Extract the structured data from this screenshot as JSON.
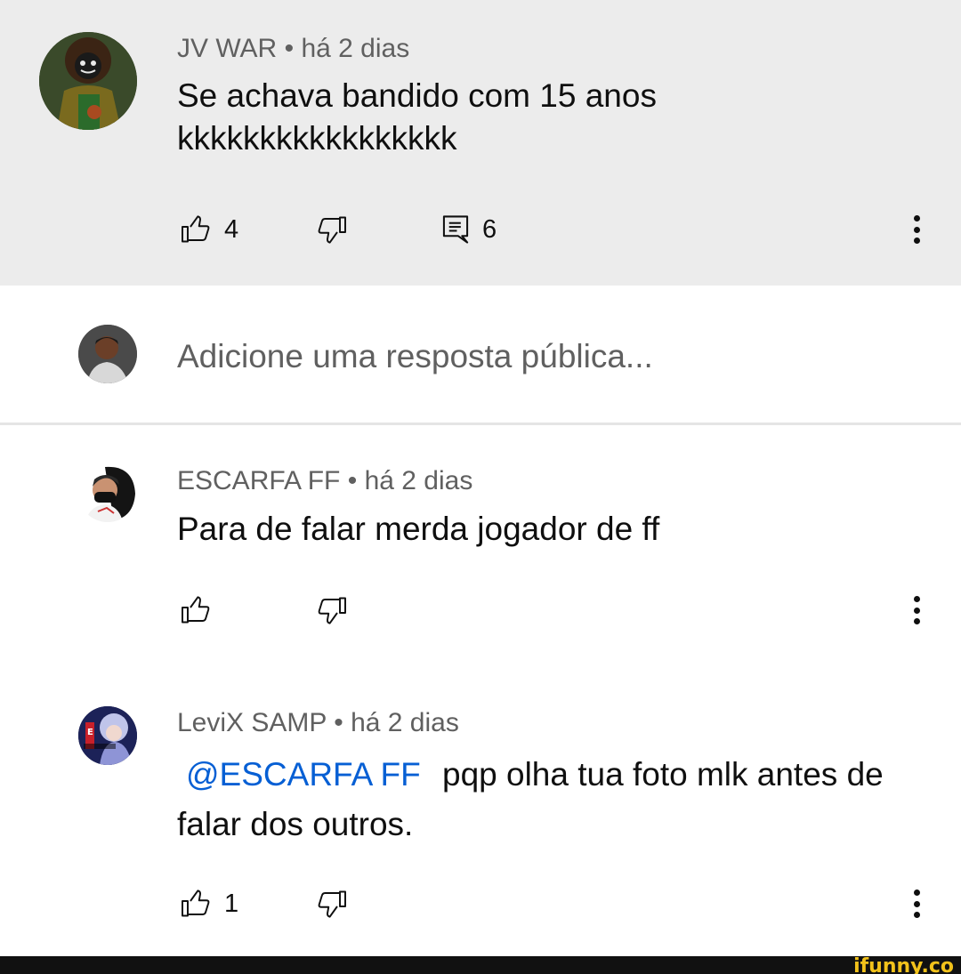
{
  "comment_main": {
    "author": "JV WAR",
    "separator": "•",
    "time": "há 2 dias",
    "text_line1": "Se achava bandido com 15 anos",
    "text_line2": "kkkkkkkkkkkkkkkkk",
    "likes": "4",
    "replies": "6",
    "avatar_icon": "jv-war-avatar"
  },
  "composer": {
    "placeholder": "Adicione uma resposta pública...",
    "avatar_icon": "current-user-avatar"
  },
  "replies": [
    {
      "author": "ESCARFA FF",
      "separator": "•",
      "time": "há 2 dias",
      "text": "Para de falar merda jogador de ff",
      "avatar_icon": "escarfa-ff-avatar"
    },
    {
      "author": "LeviX SAMP",
      "separator": "•",
      "time": "há 2 dias",
      "mention": "@ESCARFA FF",
      "text_line1": "pqp olha tua foto mlk antes de",
      "text_line2": "falar dos outros.",
      "likes": "1",
      "avatar_icon": "levix-samp-avatar"
    }
  ],
  "watermark": "ifunny.co",
  "colors": {
    "highlight_bg": "#ececec",
    "meta_text": "#606060",
    "mention": "#065fd4",
    "watermark": "#f2c21b"
  }
}
